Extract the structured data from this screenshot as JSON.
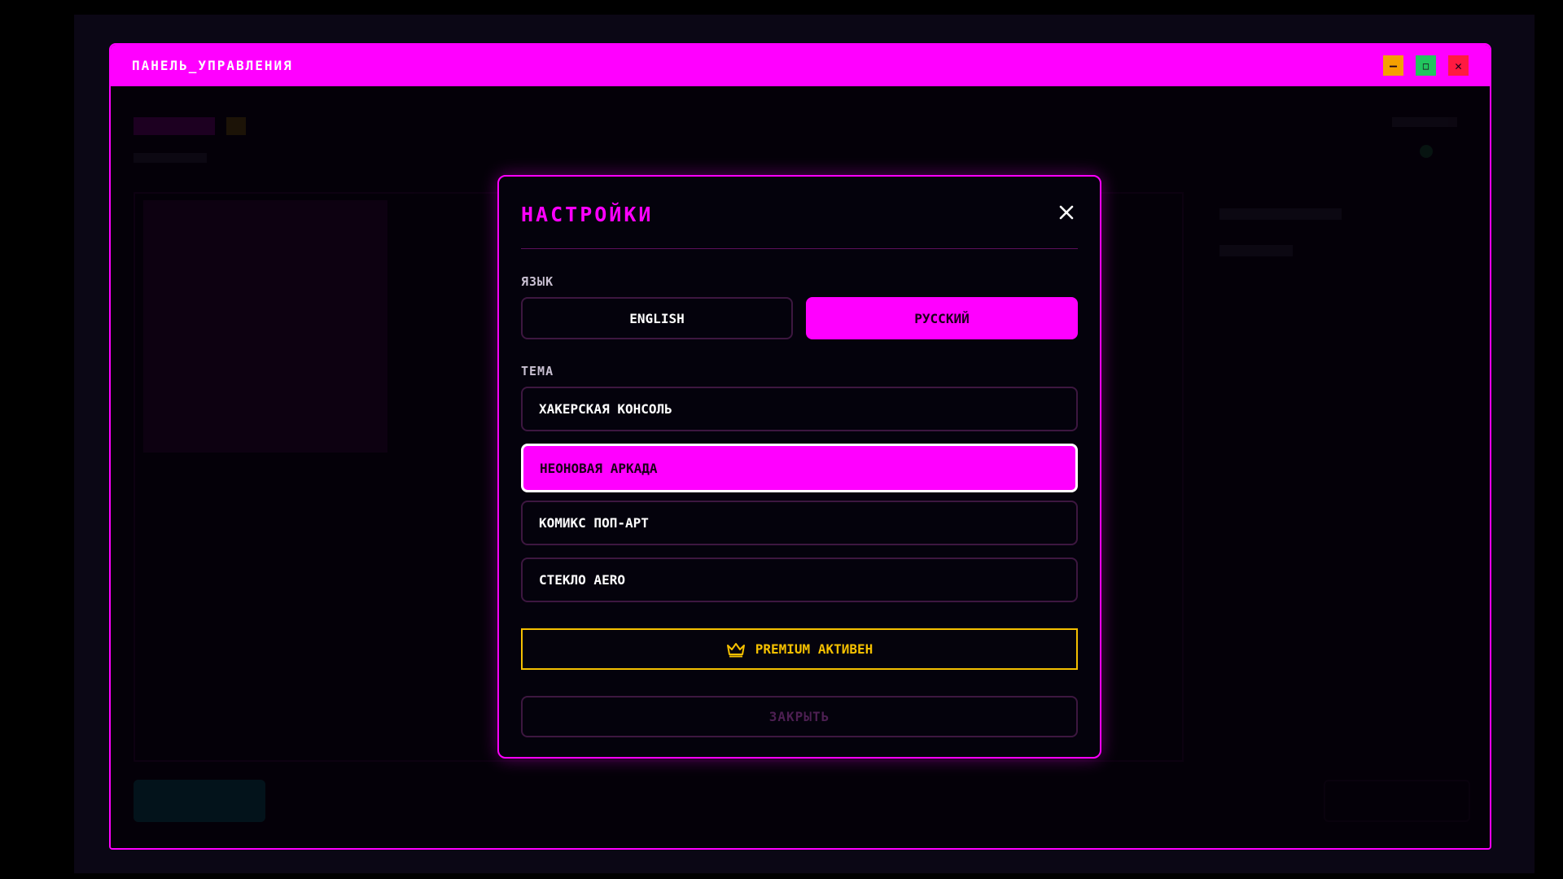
{
  "window": {
    "title": "ПАНЕЛЬ_УПРАВЛЕНИЯ",
    "controls": [
      "minimize",
      "maximize",
      "close"
    ],
    "colors": {
      "accent": "#ff00ff",
      "minimize": "#f5a000",
      "maximize": "#22c55e",
      "close": "#ff1a40"
    }
  },
  "settings_modal": {
    "title": "НАСТРОЙКИ",
    "language": {
      "label": "ЯЗЫК",
      "options": [
        {
          "label": "ENGLISH",
          "selected": false
        },
        {
          "label": "РУССКИЙ",
          "selected": true
        }
      ]
    },
    "theme": {
      "label": "ТЕМА",
      "options": [
        {
          "label": "ХАКЕРСКАЯ КОНСОЛЬ",
          "selected": false
        },
        {
          "label": "НЕОНОВАЯ АРКАДА",
          "selected": true
        },
        {
          "label": "КОМИКС ПОП-АРТ",
          "selected": false
        },
        {
          "label": "СТЕКЛО AERO",
          "selected": false
        }
      ]
    },
    "premium": {
      "label": "PREMIUM АКТИВЕН",
      "icon": "crown-icon",
      "color": "#f5c000"
    },
    "close_button": {
      "label": "ЗАКРЫТЬ"
    }
  }
}
